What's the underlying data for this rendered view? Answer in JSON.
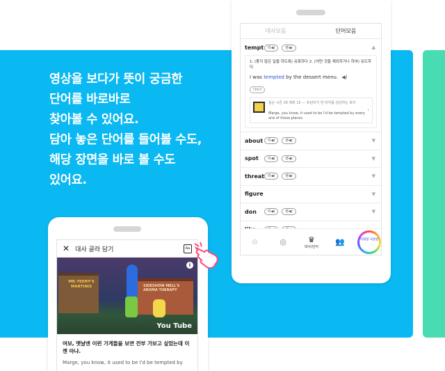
{
  "headline": "영상을 보다가 뜻이 궁금한\n단어를 바로바로\n찾아볼 수 있어요.\n담아 놓은 단어를 들어볼 수도,\n해당 장면을 바로 볼 수도\n있어요.",
  "right_screen": {
    "tabs": [
      {
        "label": "대사모음",
        "active": false
      },
      {
        "label": "단어모음",
        "active": true
      }
    ],
    "expanded_word": {
      "word": "tempt",
      "pron_us": "미◀)",
      "pron_uk": "영◀)",
      "definition": "1. (좋지 않은 일을 하도록) 유혹하다   2. (어떤 것을 제외하거나 하여) 유도하다",
      "example_pre": "I was ",
      "example_hl": "tempted",
      "example_post": " by the dessert menu.",
      "more_label": "더보기",
      "scene_title": "심슨 시즌 28 에피 15 — 프린터가 한 마지를 성냥하는 호이",
      "scene_sub": "Marge, you know, it used to be I'd be tempted by every one of these places."
    },
    "words": [
      {
        "word": "about",
        "pron_us": "미◀)",
        "pron_uk": "영◀)"
      },
      {
        "word": "spot",
        "pron_us": "미◀)",
        "pron_uk": "영◀)"
      },
      {
        "word": "threat",
        "pron_us": "미◀)",
        "pron_uk": "영◀)"
      },
      {
        "word": "figure",
        "pron_us": "",
        "pron_uk": ""
      },
      {
        "word": "don",
        "pron_us": "미◀)",
        "pron_uk": "영◀)"
      },
      {
        "word": "like",
        "pron_us": "미◀)",
        "pron_uk": "영◀)"
      }
    ],
    "bottom_nav": {
      "active_label": "대사/단어",
      "ring_label": "어휘왕 사용법"
    }
  },
  "left_screen": {
    "title": "대사 골라 담기",
    "video_sign1": "MR.TEENY'S MARTINIS",
    "video_sign2": "SIDESHOW MELL'S AROMA THERAPY",
    "youtube_label": "You Tube",
    "subtitle_ko": "여보, 옛날엔 이런 가게들을 보면 전부 가보고 싶었는데 이젠 아냐.",
    "subtitle_en": "Marge, you know, it used to be I'd be tempted by"
  },
  "colors": {
    "band": "#0ab8f2",
    "green": "#47dcb2",
    "highlight": "#3050d8"
  }
}
